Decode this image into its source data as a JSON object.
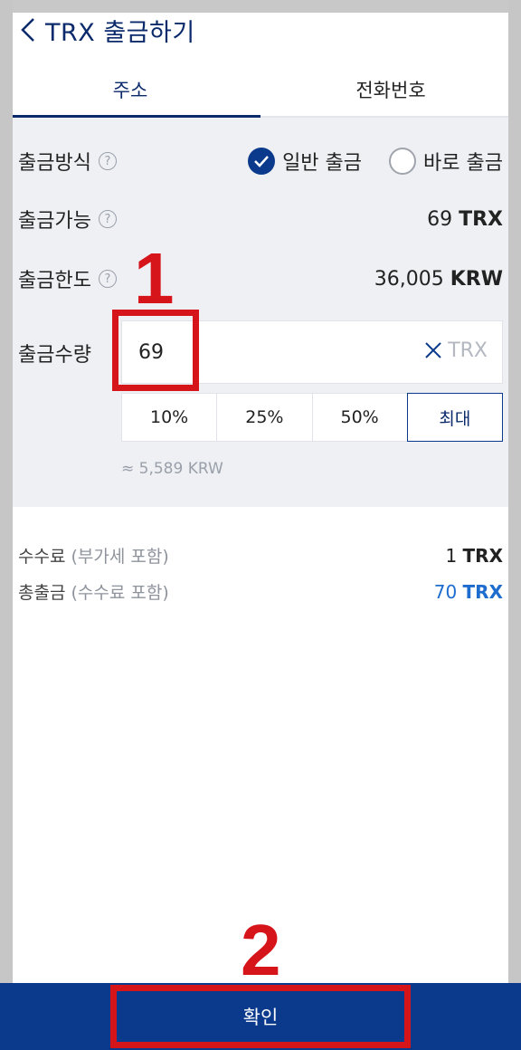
{
  "header": {
    "title": "TRX 출금하기"
  },
  "tabs": [
    {
      "label": "주소"
    },
    {
      "label": "전화번호"
    }
  ],
  "method": {
    "label": "출금방식",
    "options": [
      {
        "label": "일반 출금"
      },
      {
        "label": "바로 출금"
      }
    ]
  },
  "available": {
    "label": "출금가능",
    "amount": "69",
    "unit": "TRX"
  },
  "limit": {
    "label": "출금한도",
    "amount": "36,005",
    "unit": "KRW"
  },
  "quantity": {
    "label": "출금수량",
    "value": "69",
    "unit": "TRX",
    "percent_buttons": [
      "10%",
      "25%",
      "50%",
      "최대"
    ],
    "approx": "≈ 5,589 KRW"
  },
  "fee": {
    "label": "수수료",
    "note": "(부가세 포함)",
    "amount": "1",
    "unit": "TRX"
  },
  "total": {
    "label": "총출금",
    "note": "(수수료 포함)",
    "amount": "70",
    "unit": "TRX"
  },
  "confirm": {
    "label": "확인"
  },
  "annotations": {
    "step1": "1",
    "step2": "2"
  },
  "colors": {
    "brand_navy": "#0b3a8c",
    "accent_blue": "#1f6ccf",
    "annotation_red": "#d6151a"
  }
}
